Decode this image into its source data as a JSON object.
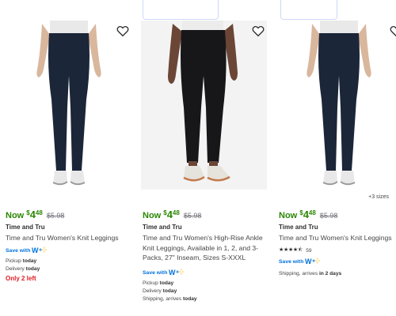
{
  "products": [
    {
      "price_prefix": "Now",
      "price_currency": "$",
      "price_whole": "4",
      "price_cents": "48",
      "was_price": "$5.98",
      "brand": "Time and Tru",
      "title": "Time and Tru Women's Knit Leggings",
      "save_with": "Save with",
      "fulfillment": [
        {
          "label": "Pickup",
          "value": "today"
        },
        {
          "label": "Delivery",
          "value": "today"
        }
      ],
      "low_stock": "Only 2 left",
      "legging_color": "#1c2639"
    },
    {
      "price_prefix": "Now",
      "price_currency": "$",
      "price_whole": "4",
      "price_cents": "48",
      "was_price": "$5.98",
      "brand": "Time and Tru",
      "title": "Time and Tru Women's High-Rise Ankle Knit Leggings, Available in 1, 2, and 3-Packs, 27\" Inseam, Sizes S-XXXL",
      "save_with": "Save with",
      "fulfillment": [
        {
          "label": "Pickup",
          "value": "today"
        },
        {
          "label": "Delivery",
          "value": "today"
        },
        {
          "label": "Shipping, arrives",
          "value": "today"
        }
      ],
      "legging_color": "#17171a"
    },
    {
      "sizes_note": "+3 sizes",
      "price_prefix": "Now",
      "price_currency": "$",
      "price_whole": "4",
      "price_cents": "48",
      "was_price": "$5.98",
      "brand": "Time and Tru",
      "title": "Time and Tru Women's Knit Leggings",
      "rating_stars": "★★★★⯪",
      "rating_value": 4.5,
      "rating_count": "59",
      "save_with": "Save with",
      "fulfillment": [
        {
          "label": "Shipping, arrives",
          "value": "in 2 days"
        }
      ],
      "legging_color": "#1c2639"
    }
  ],
  "colors": {
    "price_green": "#2a8703",
    "link_blue": "#0071dc",
    "alert_red": "#de1c24",
    "wplus_yellow": "#ffc220"
  },
  "icons": {
    "favorite": "heart-outline-icon",
    "wplus": "walmart-plus-logo"
  }
}
